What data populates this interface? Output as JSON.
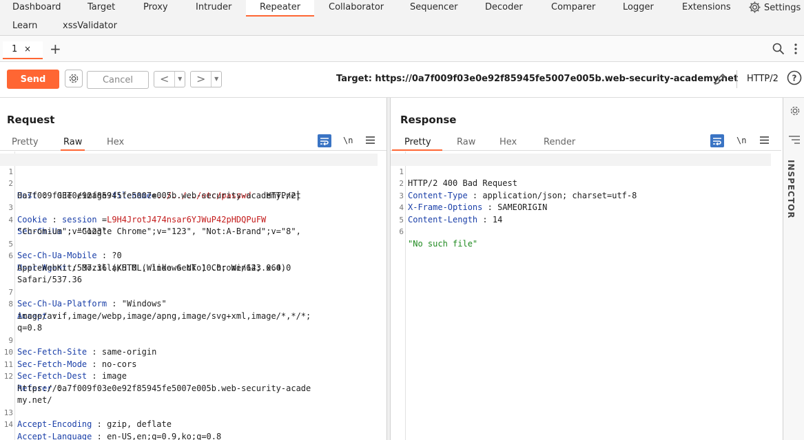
{
  "nav": {
    "tabs": [
      {
        "label": "Dashboard"
      },
      {
        "label": "Target"
      },
      {
        "label": "Proxy"
      },
      {
        "label": "Intruder"
      },
      {
        "label": "Repeater"
      },
      {
        "label": "Collaborator"
      },
      {
        "label": "Sequencer"
      },
      {
        "label": "Decoder"
      },
      {
        "label": "Comparer"
      },
      {
        "label": "Logger"
      },
      {
        "label": "Extensions"
      }
    ],
    "row2": [
      {
        "label": "Learn"
      },
      {
        "label": "xssValidator"
      }
    ],
    "settings_label": "Settings",
    "active_tab": "Repeater"
  },
  "repeater_tabs": {
    "current": "1",
    "close": "×",
    "add": "+"
  },
  "toolbar": {
    "send_label": "Send",
    "cancel_label": "Cancel",
    "target_text": "Target: https://0a7f009f03e0e92f85945fe5007e005b.web-security-academy.net",
    "protocol": "HTTP/2"
  },
  "request": {
    "title": "Request",
    "tabs": [
      "Pretty",
      "Raw",
      "Hex"
    ],
    "active_tab": "Raw",
    "lines": {
      "l1": {
        "method": "GET",
        "path": "/image",
        "q": "?",
        "param": "filename",
        "eq": "=",
        "value": "../../../etc/passwd",
        "proto": "HTTP/2"
      },
      "host_key": "Host",
      "host_val": "0a7f009f03e0e92f85945fe5007e005b.web-security-academy.net",
      "cookie_key": "Cookie",
      "cookie_name": "session",
      "cookie_eq": "=",
      "cookie_val": "L9H4JrotJ474nsar6YJWuP42pHDQPuFW",
      "secchua_key": "Sec-Ch-Ua",
      "secchua_val1": "\"Google Chrome\";v=\"123\", \"Not:A-Brand\";v=\"8\",",
      "secchua_val2": "\"Chromium\";v=\"123\"",
      "mobile_key": "Sec-Ch-Ua-Mobile",
      "mobile_val": "?0",
      "ua_key": "User-Agent",
      "ua_val1": "Mozilla/5.0 (Windows NT 10.0; Win64; x64)",
      "ua_val2": "AppleWebKit/537.36 (KHTML, like Gecko) Chrome/123.0.0.0",
      "ua_val3": "Safari/537.36",
      "platform_key": "Sec-Ch-Ua-Platform",
      "platform_val": "\"Windows\"",
      "accept_key": "Accept",
      "accept_val1": "image/avif,image/webp,image/apng,image/svg+xml,image/*,*/*;",
      "accept_val2": "q=0.8",
      "site_key": "Sec-Fetch-Site",
      "site_val": "same-origin",
      "mode_key": "Sec-Fetch-Mode",
      "mode_val": "no-cors",
      "dest_key": "Sec-Fetch-Dest",
      "dest_val": "image",
      "referer_key": "Referer",
      "referer_val1": "https://0a7f009f03e0e92f85945fe5007e005b.web-security-acade",
      "referer_val2": "my.net/",
      "enc_key": "Accept-Encoding",
      "enc_val": "gzip, deflate",
      "lang_key": "Accept-Language",
      "lang_val": "en-US,en;q=0.9,ko;q=0.8"
    }
  },
  "response": {
    "title": "Response",
    "tabs": [
      "Pretty",
      "Raw",
      "Hex",
      "Render"
    ],
    "active_tab": "Pretty",
    "status": "HTTP/2 400 Bad Request",
    "ct_key": "Content-Type",
    "ct_val": "application/json; charset=utf-8",
    "xfo_key": "X-Frame-Options",
    "xfo_val": "SAMEORIGIN",
    "cl_key": "Content-Length",
    "cl_val": "14",
    "body": "\"No such file\""
  },
  "inspector_label": "INSPECTOR",
  "line_numbers": [
    "1",
    "2",
    "3",
    "4",
    "5",
    "6",
    "7",
    "8",
    "9",
    "10",
    "11",
    "12",
    "13",
    "14"
  ],
  "colors": {
    "accent": "#ff6633",
    "header_key": "#1a3fa8",
    "param_value": "#c31a1a",
    "json_string": "#1f8a1f",
    "toggle_active": "#3a74c4"
  }
}
